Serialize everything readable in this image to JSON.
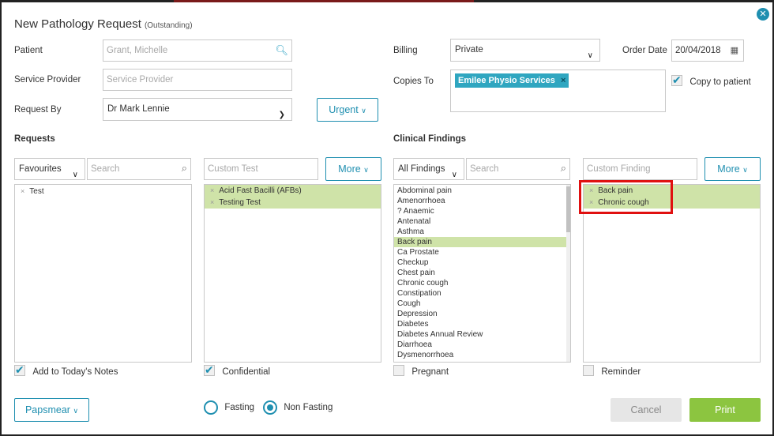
{
  "dialog": {
    "title": "New Pathology Request",
    "status": "(Outstanding)",
    "close_icon": "close-icon"
  },
  "patient": {
    "label": "Patient",
    "value": "Grant, Michelle"
  },
  "service_provider": {
    "label": "Service Provider",
    "placeholder": "Service Provider"
  },
  "request_by": {
    "label": "Request By",
    "value": "Dr Mark Lennie"
  },
  "urgent_button": "Urgent",
  "billing": {
    "label": "Billing",
    "value": "Private"
  },
  "order_date": {
    "label": "Order Date",
    "value": "20/04/2018"
  },
  "copies_to": {
    "label": "Copies To",
    "tag": "Emilee Physio Services",
    "tag_remove": "×"
  },
  "copy_to_patient": {
    "label": "Copy to patient",
    "checked": true
  },
  "requests": {
    "header": "Requests",
    "filter": "Favourites",
    "search_placeholder": "Search",
    "items": [
      {
        "remove": "×",
        "label": "Test"
      }
    ],
    "custom_placeholder": "Custom Test",
    "more": "More",
    "selected": [
      {
        "remove": "×",
        "label": "Acid Fast Bacilli (AFBs)"
      },
      {
        "remove": "×",
        "label": "Testing Test"
      }
    ],
    "add_to_notes": {
      "label": "Add to Today's Notes",
      "checked": true
    },
    "confidential": {
      "label": "Confidential",
      "checked": true
    }
  },
  "clinical": {
    "header": "Clinical Findings",
    "filter": "All Findings",
    "search_placeholder": "Search",
    "list": [
      "Abdominal pain",
      "Amenorrhoea",
      "? Anaemic",
      "Antenatal",
      "Asthma",
      "Back pain",
      "Ca Prostate",
      "Checkup",
      "Chest pain",
      "Chronic cough",
      "Constipation",
      "Cough",
      "Depression",
      "Diabetes",
      "Diabetes Annual Review",
      "Diarrhoea",
      "Dysmenorrhoea"
    ],
    "list_selected": "Back pain",
    "custom_placeholder": "Custom Finding",
    "more": "More",
    "selected": [
      {
        "remove": "×",
        "label": "Back pain"
      },
      {
        "remove": "×",
        "label": "Chronic cough"
      }
    ],
    "pregnant": {
      "label": "Pregnant",
      "checked": false
    },
    "reminder": {
      "label": "Reminder",
      "checked": false
    }
  },
  "papsmear": "Papsmear",
  "fasting": {
    "label": "Fasting",
    "selected": false
  },
  "non_fasting": {
    "label": "Non Fasting",
    "selected": true
  },
  "cancel": "Cancel",
  "print": "Print",
  "colors": {
    "accent": "#1f8fb0",
    "selected_row": "#cfe3a8",
    "print": "#8cc540",
    "highlight": "#e01010"
  }
}
